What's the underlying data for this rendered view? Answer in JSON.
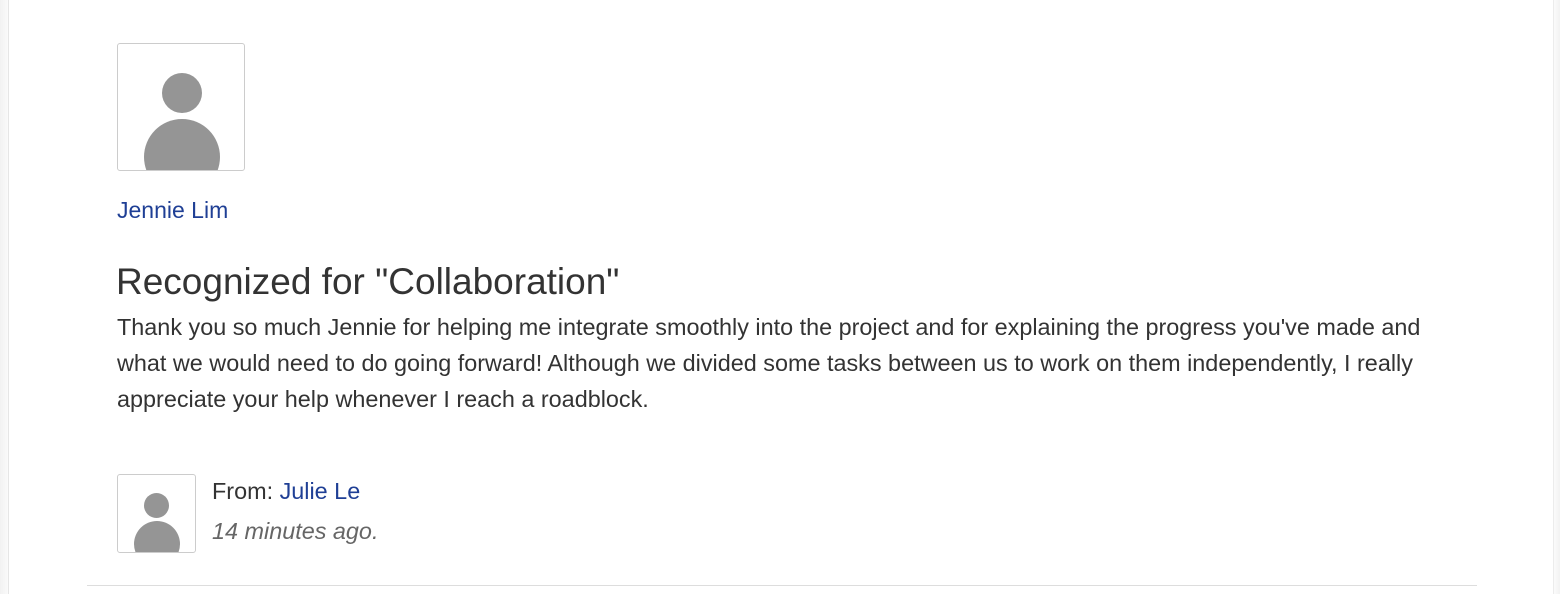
{
  "recipient": {
    "name": "Jennie Lim",
    "avatar_icon": "user-silhouette-icon"
  },
  "recognition": {
    "title": "Recognized for \"Collaboration\"",
    "message": "Thank you so much Jennie for helping me integrate smoothly into the project and for explaining the progress you've made and what we would need to do going forward! Although we divided some tasks between us to work on them independently, I really appreciate your help whenever I reach a roadblock."
  },
  "sender": {
    "from_label": "From:",
    "name": "Julie Le",
    "avatar_icon": "user-silhouette-icon",
    "time_ago": "14 minutes ago."
  },
  "colors": {
    "link": "#1f3f95",
    "text": "#333333",
    "muted": "#666666",
    "avatar_fill": "#959595",
    "border": "#cccccc"
  }
}
